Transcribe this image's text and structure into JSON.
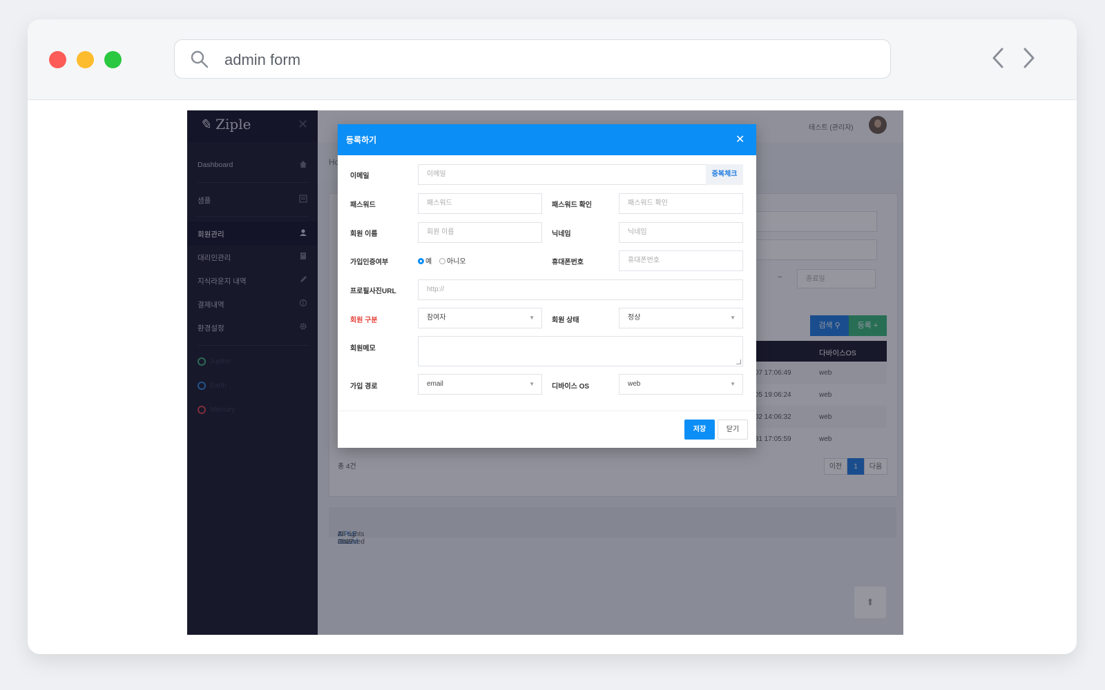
{
  "browser": {
    "search_query": "admin form"
  },
  "sidebar": {
    "logo": "Ziple",
    "items": [
      {
        "label": "Dashboard",
        "icon": "home-icon"
      },
      {
        "label": "샘플",
        "icon": "list-icon"
      },
      {
        "label": "회원관리",
        "icon": "user-icon"
      },
      {
        "label": "대리인관리",
        "icon": "book-icon"
      },
      {
        "label": "지식라운지 내역",
        "icon": "pen-icon"
      },
      {
        "label": "결제내역",
        "icon": "dollar-icon"
      },
      {
        "label": "환경설정",
        "icon": "gear-icon"
      }
    ],
    "planets": [
      "Jupiter",
      "Earth",
      "Mercury"
    ]
  },
  "header": {
    "user_name": "테스트 (관리자)"
  },
  "background": {
    "breadcrumb": "Ho",
    "end_date_placeholder": "종료일",
    "date_separator": "~",
    "search_button": "검색",
    "add_button": "등록",
    "table_header_device": "다바이스OS",
    "rows": [
      {
        "date": ".07 17:06:49",
        "os": "web"
      },
      {
        "date": ".05 19:06:24",
        "os": "web"
      },
      {
        "date": ".02 14:06:32",
        "os": "web"
      },
      {
        "date": ".31 17:05:59",
        "os": "web"
      }
    ],
    "total": "총 4건",
    "pager": {
      "prev": "이전",
      "current": "1",
      "next": "다음"
    },
    "footer": {
      "prefix": "© 2017 ",
      "company": "ZIPLE Co.Ltd",
      "suffix": " All rights reserved"
    }
  },
  "modal": {
    "title": "등록하기",
    "fields": {
      "email": {
        "label": "이메일",
        "placeholder": "이메일",
        "check_button": "중복체크"
      },
      "password": {
        "label": "패스워드",
        "placeholder": "패스워드"
      },
      "password_confirm": {
        "label": "패스워드 확인",
        "placeholder": "패스워드 확인"
      },
      "name": {
        "label": "회원 이름",
        "placeholder": "회원 이름"
      },
      "nickname": {
        "label": "닉네임",
        "placeholder": "닉네임"
      },
      "verified": {
        "label": "가입인증여부",
        "yes": "예",
        "no": "아니오"
      },
      "phone": {
        "label": "휴대폰번호",
        "placeholder": "휴대폰번호"
      },
      "profile_url": {
        "label": "프로필사진URL",
        "placeholder": "http://"
      },
      "member_type": {
        "label": "회원 구분",
        "value": "참여자"
      },
      "member_status": {
        "label": "회원 상태",
        "value": "정상"
      },
      "memo": {
        "label": "회원메모"
      },
      "signup_route": {
        "label": "가입 경로",
        "value": "email"
      },
      "device_os": {
        "label": "디바이스 OS",
        "value": "web"
      }
    },
    "save_button": "저장",
    "close_button": "닫기"
  }
}
